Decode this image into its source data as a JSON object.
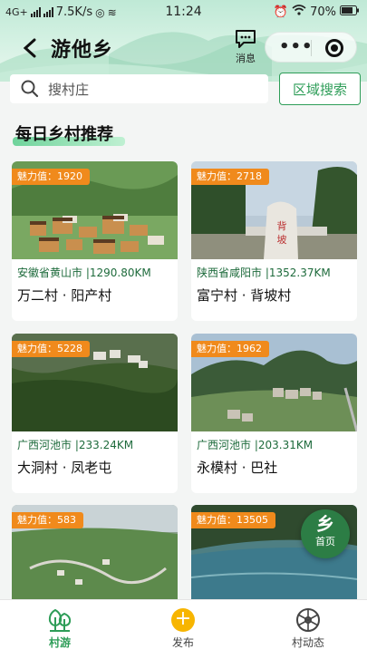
{
  "status": {
    "network": "4G+",
    "speed": "7.5K/s",
    "time": "11:24",
    "battery": "70%"
  },
  "header": {
    "title": "游他乡",
    "message_label": "消息",
    "more_icon": "more-dots-icon",
    "close_icon": "target-icon"
  },
  "search": {
    "placeholder": "搜村庄",
    "region_button": "区域搜索"
  },
  "section": {
    "title": "每日乡村推荐"
  },
  "colors": {
    "accent": "#2e9d58",
    "badge": "#f08a1c",
    "location": "#1e6b3c"
  },
  "villages": [
    {
      "charm": "魅力值：1920",
      "location": "安徽省黄山市 |1290.80KM",
      "name": "万二村 · 阳产村"
    },
    {
      "charm": "魅力值：2718",
      "location": "陕西省咸阳市 |1352.37KM",
      "name": "富宁村 · 背坡村"
    },
    {
      "charm": "魅力值：5228",
      "location": "广西河池市 |233.24KM",
      "name": "大洞村 · 凤老屯"
    },
    {
      "charm": "魅力值：1962",
      "location": "广西河池市 |203.31KM",
      "name": "永模村 · 巴社"
    },
    {
      "charm": "魅力值：583",
      "location": "",
      "name": ""
    },
    {
      "charm": "魅力值：13505",
      "location": "",
      "name": ""
    }
  ],
  "fab": {
    "glyph": "乡",
    "label": "首页"
  },
  "tabs": [
    {
      "label": "村游",
      "icon": "tree-icon"
    },
    {
      "label": "发布",
      "icon": "plus-icon"
    },
    {
      "label": "村动态",
      "icon": "wheel-icon"
    }
  ]
}
